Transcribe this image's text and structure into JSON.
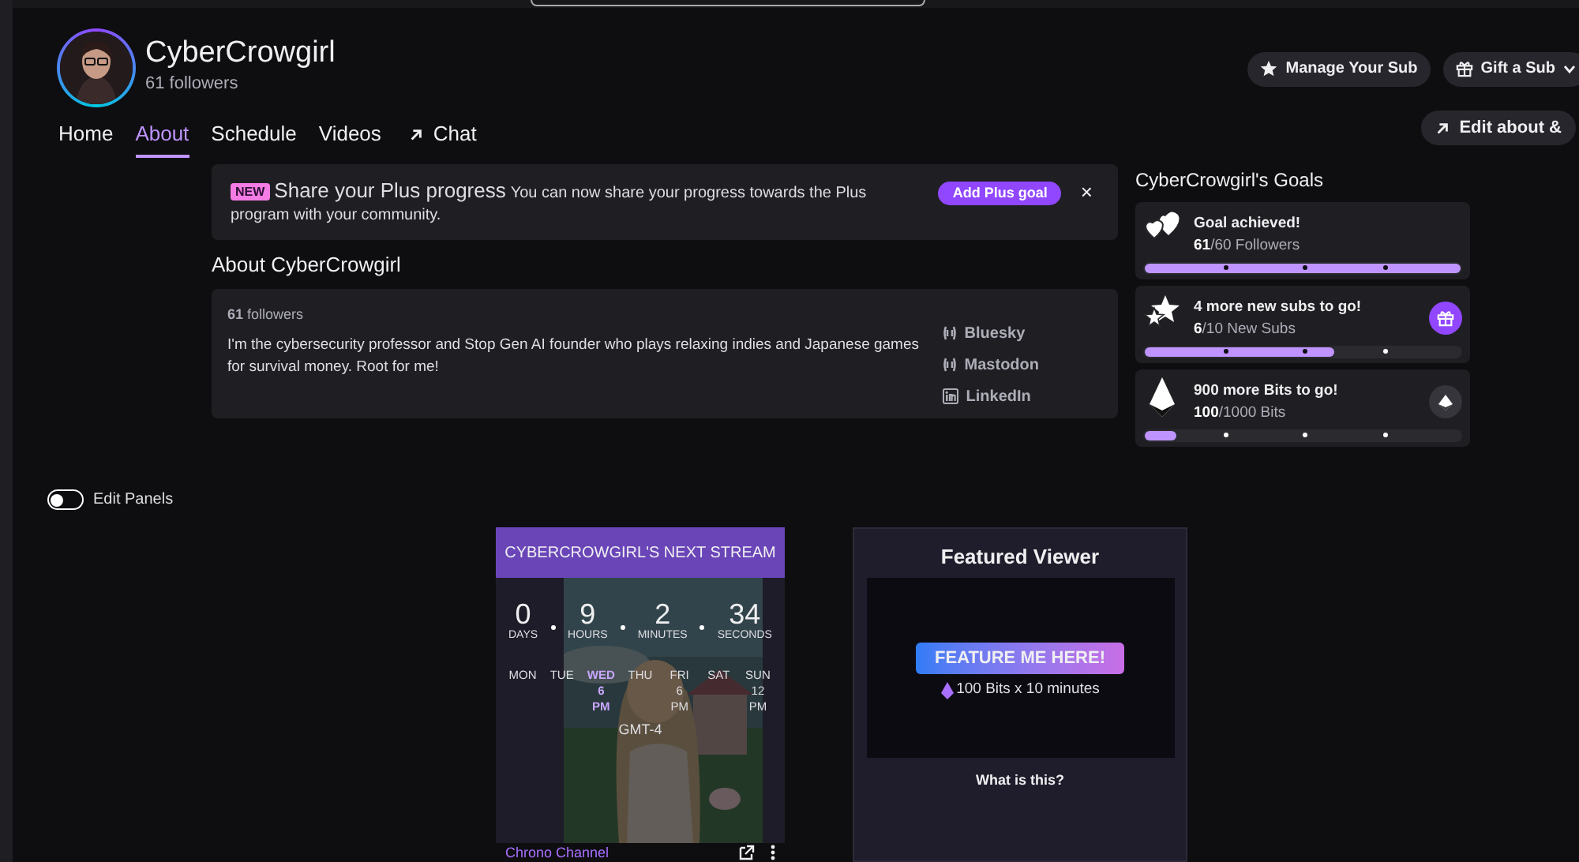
{
  "channel": {
    "name": "CyberCrowgirl",
    "followers": "61 followers"
  },
  "header_buttons": [
    {
      "kind": "star",
      "label": "Manage Your Sub"
    },
    {
      "kind": "gift",
      "label": "Gift a Sub"
    }
  ],
  "tabs": [
    {
      "label": "Home",
      "selected": false,
      "external": false
    },
    {
      "label": "About",
      "selected": true,
      "external": false
    },
    {
      "label": "Schedule",
      "selected": false,
      "external": false
    },
    {
      "label": "Videos",
      "selected": false,
      "external": false
    },
    {
      "label": "Chat",
      "selected": false,
      "external": true
    }
  ],
  "edit_about_button": "Edit about &",
  "banner": {
    "badge": "NEW",
    "title": "Share your Plus progress",
    "text": "You can now share your progress towards the Plus program with your community.",
    "button": "Add Plus goal",
    "close": "×"
  },
  "about": {
    "heading": "About CyberCrowgirl",
    "followers": "**61** followers",
    "bio": "I'm the cybersecurity professor and Stop Gen AI founder who plays relaxing indies and Japanese games for survival money. Root for me!",
    "links": [
      {
        "kind": "social",
        "label": "Bluesky"
      },
      {
        "kind": "social",
        "label": "Mastodon"
      },
      {
        "kind": "linkedin",
        "label": "LinkedIn"
      }
    ]
  },
  "goals": {
    "heading": "CyberCrowgirl's Goals",
    "items": [
      {
        "kind": "followers",
        "title": "Goal achieved!",
        "progress": "**61**/60 Followers",
        "level": 1
      },
      {
        "kind": "subs",
        "title": "4 more new subs to go!",
        "progress": "**6**/10 New Subs",
        "level": 0.6
      },
      {
        "kind": "bits",
        "title": "900 more Bits to go!",
        "progress": "**100**/1000 Bits",
        "level": 0.1
      }
    ]
  },
  "edit_panels": {
    "label": "Edit Panels",
    "on": false
  },
  "next_stream": {
    "title": "CYBERCROWGIRL'S NEXT STREAM",
    "countdown": [
      {
        "value": "0",
        "unit": "DAYS"
      },
      {
        "value": "9",
        "unit": "HOURS"
      },
      {
        "value": "2",
        "unit": "MINUTES"
      },
      {
        "value": "34",
        "unit": "SECONDS"
      }
    ],
    "days": [
      {
        "day": "MON",
        "current": false
      },
      {
        "day": "TUE",
        "current": false
      },
      {
        "day": "WED",
        "time": [
          "6",
          "PM"
        ],
        "current": true
      },
      {
        "day": "THU",
        "current": false
      },
      {
        "day": "FRI",
        "time": [
          "6",
          "PM"
        ],
        "current": false
      },
      {
        "day": "SAT",
        "current": false
      },
      {
        "day": "SUN",
        "time": [
          "12",
          "PM"
        ],
        "current": false
      }
    ],
    "timezone": "GMT-4",
    "footer_link": "Chrono Channel"
  },
  "featured_viewer": {
    "title": "Featured Viewer",
    "button": "FEATURE ME HERE!",
    "price": "100 Bits x 10 minutes",
    "help": "What is this?"
  }
}
